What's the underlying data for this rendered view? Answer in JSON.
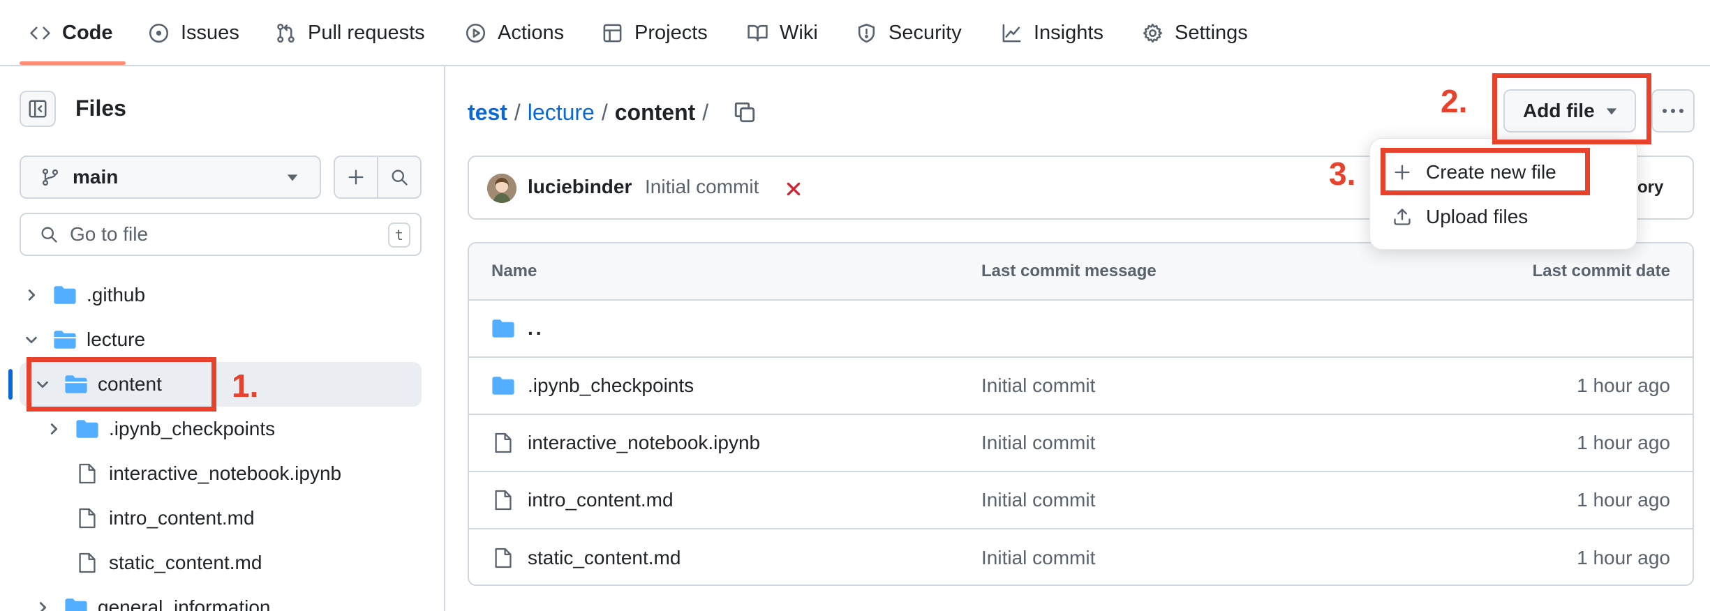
{
  "nav": {
    "tabs": [
      {
        "label": "Code",
        "icon": "code-icon",
        "active": true
      },
      {
        "label": "Issues",
        "icon": "issue-icon"
      },
      {
        "label": "Pull requests",
        "icon": "pull-request-icon"
      },
      {
        "label": "Actions",
        "icon": "play-icon"
      },
      {
        "label": "Projects",
        "icon": "table-icon"
      },
      {
        "label": "Wiki",
        "icon": "book-icon"
      },
      {
        "label": "Security",
        "icon": "shield-icon"
      },
      {
        "label": "Insights",
        "icon": "graph-icon"
      },
      {
        "label": "Settings",
        "icon": "gear-icon"
      }
    ]
  },
  "sidebar": {
    "title": "Files",
    "branch": "main",
    "search_placeholder": "Go to file",
    "search_shortcut": "t",
    "tree": [
      {
        "label": ".github",
        "type": "folder",
        "expanded": false
      },
      {
        "label": "lecture",
        "type": "folder",
        "expanded": true
      },
      {
        "label": "content",
        "type": "folder",
        "expanded": true,
        "selected": true
      },
      {
        "label": ".ipynb_checkpoints",
        "type": "folder",
        "expanded": false
      },
      {
        "label": "interactive_notebook.ipynb",
        "type": "file"
      },
      {
        "label": "intro_content.md",
        "type": "file"
      },
      {
        "label": "static_content.md",
        "type": "file"
      },
      {
        "label": "general_information",
        "type": "folder",
        "expanded": false
      }
    ]
  },
  "breadcrumb": {
    "repo": "test",
    "sep": "/",
    "folder": "lecture",
    "current": "content"
  },
  "actions": {
    "add_file_label": "Add file",
    "menu": [
      {
        "label": "Create new file",
        "icon": "plus-icon"
      },
      {
        "label": "Upload files",
        "icon": "upload-icon"
      }
    ]
  },
  "commit": {
    "author": "luciebinder",
    "message": "Initial commit",
    "history_label": "tory"
  },
  "table": {
    "headers": {
      "name": "Name",
      "message": "Last commit message",
      "date": "Last commit date"
    },
    "parent_label": "..",
    "rows": [
      {
        "name": ".ipynb_checkpoints",
        "type": "folder",
        "message": "Initial commit",
        "date": "1 hour ago"
      },
      {
        "name": "interactive_notebook.ipynb",
        "type": "file",
        "message": "Initial commit",
        "date": "1 hour ago"
      },
      {
        "name": "intro_content.md",
        "type": "file",
        "message": "Initial commit",
        "date": "1 hour ago"
      },
      {
        "name": "static_content.md",
        "type": "file",
        "message": "Initial commit",
        "date": "1 hour ago"
      }
    ]
  },
  "annotations": {
    "step1": "1.",
    "step2": "2.",
    "step3": "3."
  },
  "colors": {
    "accent": "#0969da",
    "annotation": "#e8412c",
    "folder": "#54aeff",
    "tab_underline": "#fd8c73",
    "error": "#cf222e"
  }
}
